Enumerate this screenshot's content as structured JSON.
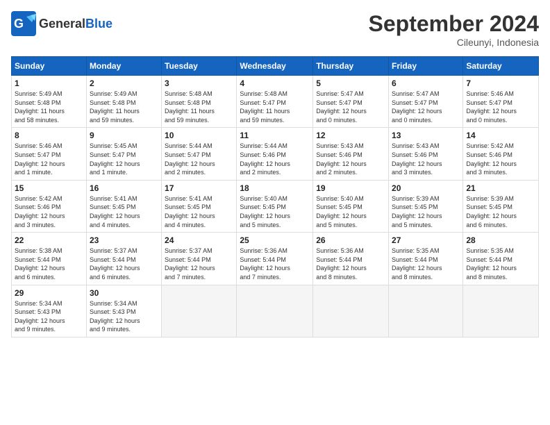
{
  "logo": {
    "general": "General",
    "blue": "Blue"
  },
  "title": "September 2024",
  "location": "Cileunyi, Indonesia",
  "days_of_week": [
    "Sunday",
    "Monday",
    "Tuesday",
    "Wednesday",
    "Thursday",
    "Friday",
    "Saturday"
  ],
  "weeks": [
    [
      {
        "day": "1",
        "info": "Sunrise: 5:49 AM\nSunset: 5:48 PM\nDaylight: 11 hours\nand 58 minutes."
      },
      {
        "day": "2",
        "info": "Sunrise: 5:49 AM\nSunset: 5:48 PM\nDaylight: 11 hours\nand 59 minutes."
      },
      {
        "day": "3",
        "info": "Sunrise: 5:48 AM\nSunset: 5:48 PM\nDaylight: 11 hours\nand 59 minutes."
      },
      {
        "day": "4",
        "info": "Sunrise: 5:48 AM\nSunset: 5:47 PM\nDaylight: 11 hours\nand 59 minutes."
      },
      {
        "day": "5",
        "info": "Sunrise: 5:47 AM\nSunset: 5:47 PM\nDaylight: 12 hours\nand 0 minutes."
      },
      {
        "day": "6",
        "info": "Sunrise: 5:47 AM\nSunset: 5:47 PM\nDaylight: 12 hours\nand 0 minutes."
      },
      {
        "day": "7",
        "info": "Sunrise: 5:46 AM\nSunset: 5:47 PM\nDaylight: 12 hours\nand 0 minutes."
      }
    ],
    [
      {
        "day": "8",
        "info": "Sunrise: 5:46 AM\nSunset: 5:47 PM\nDaylight: 12 hours\nand 1 minute."
      },
      {
        "day": "9",
        "info": "Sunrise: 5:45 AM\nSunset: 5:47 PM\nDaylight: 12 hours\nand 1 minute."
      },
      {
        "day": "10",
        "info": "Sunrise: 5:44 AM\nSunset: 5:47 PM\nDaylight: 12 hours\nand 2 minutes."
      },
      {
        "day": "11",
        "info": "Sunrise: 5:44 AM\nSunset: 5:46 PM\nDaylight: 12 hours\nand 2 minutes."
      },
      {
        "day": "12",
        "info": "Sunrise: 5:43 AM\nSunset: 5:46 PM\nDaylight: 12 hours\nand 2 minutes."
      },
      {
        "day": "13",
        "info": "Sunrise: 5:43 AM\nSunset: 5:46 PM\nDaylight: 12 hours\nand 3 minutes."
      },
      {
        "day": "14",
        "info": "Sunrise: 5:42 AM\nSunset: 5:46 PM\nDaylight: 12 hours\nand 3 minutes."
      }
    ],
    [
      {
        "day": "15",
        "info": "Sunrise: 5:42 AM\nSunset: 5:46 PM\nDaylight: 12 hours\nand 3 minutes."
      },
      {
        "day": "16",
        "info": "Sunrise: 5:41 AM\nSunset: 5:45 PM\nDaylight: 12 hours\nand 4 minutes."
      },
      {
        "day": "17",
        "info": "Sunrise: 5:41 AM\nSunset: 5:45 PM\nDaylight: 12 hours\nand 4 minutes."
      },
      {
        "day": "18",
        "info": "Sunrise: 5:40 AM\nSunset: 5:45 PM\nDaylight: 12 hours\nand 5 minutes."
      },
      {
        "day": "19",
        "info": "Sunrise: 5:40 AM\nSunset: 5:45 PM\nDaylight: 12 hours\nand 5 minutes."
      },
      {
        "day": "20",
        "info": "Sunrise: 5:39 AM\nSunset: 5:45 PM\nDaylight: 12 hours\nand 5 minutes."
      },
      {
        "day": "21",
        "info": "Sunrise: 5:39 AM\nSunset: 5:45 PM\nDaylight: 12 hours\nand 6 minutes."
      }
    ],
    [
      {
        "day": "22",
        "info": "Sunrise: 5:38 AM\nSunset: 5:44 PM\nDaylight: 12 hours\nand 6 minutes."
      },
      {
        "day": "23",
        "info": "Sunrise: 5:37 AM\nSunset: 5:44 PM\nDaylight: 12 hours\nand 6 minutes."
      },
      {
        "day": "24",
        "info": "Sunrise: 5:37 AM\nSunset: 5:44 PM\nDaylight: 12 hours\nand 7 minutes."
      },
      {
        "day": "25",
        "info": "Sunrise: 5:36 AM\nSunset: 5:44 PM\nDaylight: 12 hours\nand 7 minutes."
      },
      {
        "day": "26",
        "info": "Sunrise: 5:36 AM\nSunset: 5:44 PM\nDaylight: 12 hours\nand 8 minutes."
      },
      {
        "day": "27",
        "info": "Sunrise: 5:35 AM\nSunset: 5:44 PM\nDaylight: 12 hours\nand 8 minutes."
      },
      {
        "day": "28",
        "info": "Sunrise: 5:35 AM\nSunset: 5:44 PM\nDaylight: 12 hours\nand 8 minutes."
      }
    ],
    [
      {
        "day": "29",
        "info": "Sunrise: 5:34 AM\nSunset: 5:43 PM\nDaylight: 12 hours\nand 9 minutes."
      },
      {
        "day": "30",
        "info": "Sunrise: 5:34 AM\nSunset: 5:43 PM\nDaylight: 12 hours\nand 9 minutes."
      },
      null,
      null,
      null,
      null,
      null
    ]
  ]
}
